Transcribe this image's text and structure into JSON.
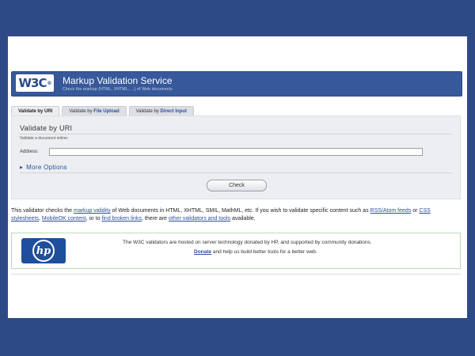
{
  "banner": {
    "logo_text": "W3C",
    "logo_mark": "®",
    "title": "Markup Validation Service",
    "subtitle": "Check the markup (HTML, XHTML, ...) of Web documents"
  },
  "tabs": [
    {
      "label": "Validate by URI"
    },
    {
      "prefix": "Validate by ",
      "accent": "File Upload"
    },
    {
      "prefix": "Validate by ",
      "accent": "Direct Input"
    }
  ],
  "form": {
    "title": "Validate by URI",
    "description": "Validate a document online:",
    "address_label": "Address:",
    "address_value": "",
    "more_options": "More Options",
    "check_label": "Check"
  },
  "about": {
    "t1": "This validator checks the ",
    "l1": "markup validity",
    "t2": " of Web documents in HTML, XHTML, SMIL, MathML, etc. If you wish to validate specific content such as ",
    "l2": "RSS/Atom feeds",
    "t3": " or ",
    "l3": "CSS stylesheets",
    "t4": ", ",
    "l4": "MobileOK content",
    "t5": ", or to ",
    "l5": "find broken links",
    "t6": ", there are ",
    "l6": "other validators and tools",
    "t7": " available."
  },
  "sponsor": {
    "logo_text": "hp",
    "line1": "The W3C validators are hosted on server technology donated by HP, and supported by community donations.",
    "donate_link": "Donate",
    "line2_rest": " and help us build better tools for a better web."
  },
  "colors": {
    "frame": "#2e4a86",
    "banner": "#37589a",
    "link": "#2b4f9a",
    "panel": "#eceef1",
    "sponsor_border": "#b9dbb5"
  }
}
